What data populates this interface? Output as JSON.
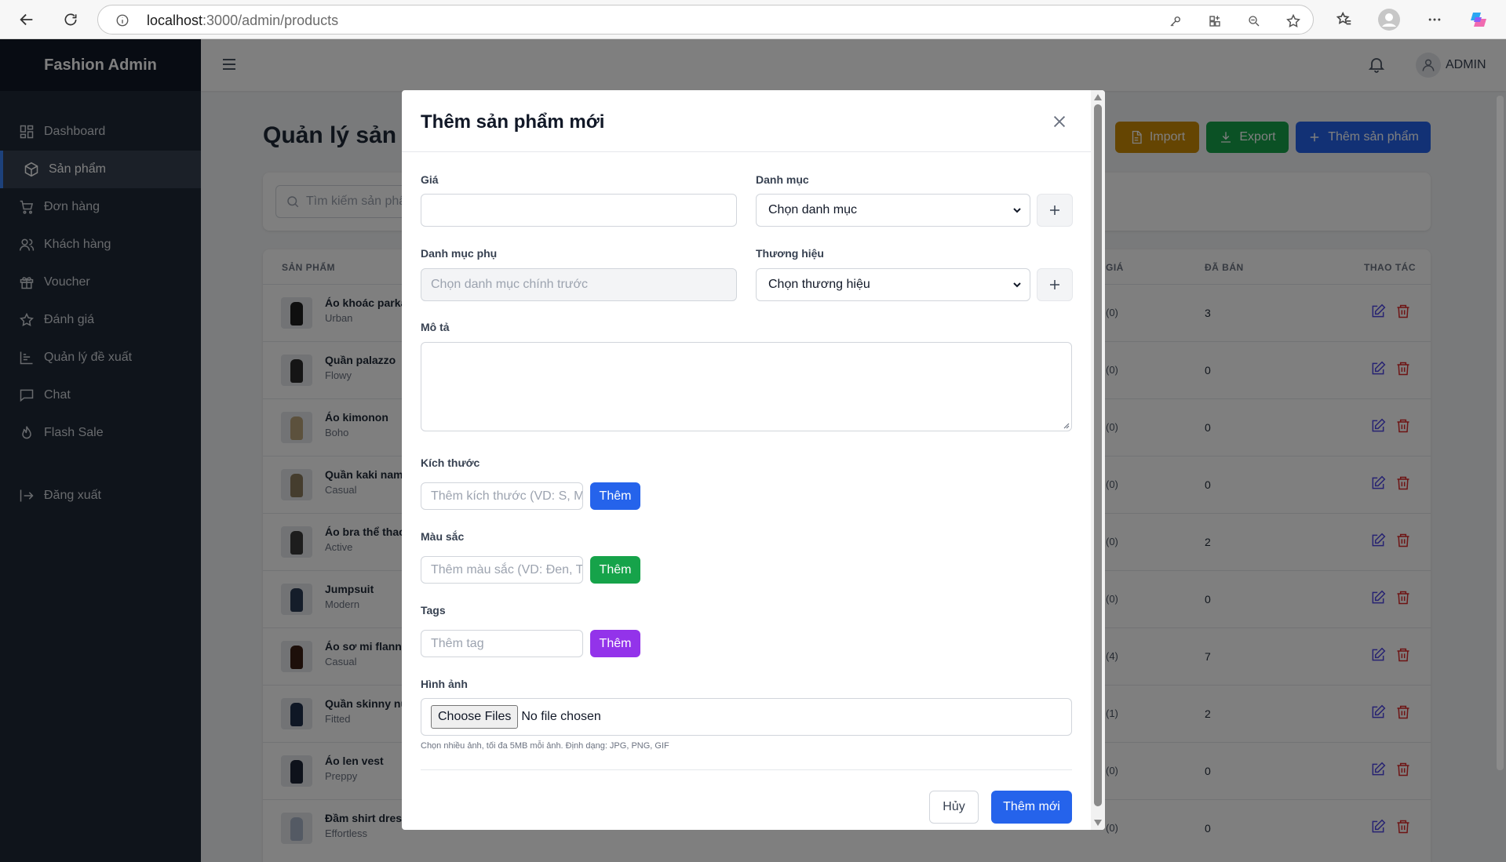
{
  "browser": {
    "url_host": "localhost",
    "url_path": ":3000/admin/products"
  },
  "sidebar": {
    "brand": "Fashion Admin",
    "items": [
      {
        "label": "Dashboard",
        "icon": "dashboard-icon"
      },
      {
        "label": "Sản phẩm",
        "icon": "box-icon",
        "active": true
      },
      {
        "label": "Đơn hàng",
        "icon": "cart-icon"
      },
      {
        "label": "Khách hàng",
        "icon": "users-icon"
      },
      {
        "label": "Voucher",
        "icon": "gift-icon"
      },
      {
        "label": "Đánh giá",
        "icon": "star-icon"
      },
      {
        "label": "Quản lý đề xuất",
        "icon": "list-icon"
      },
      {
        "label": "Chat",
        "icon": "chat-icon"
      },
      {
        "label": "Flash Sale",
        "icon": "flame-icon"
      }
    ],
    "logout": "Đăng xuất"
  },
  "topbar": {
    "user": "ADMIN"
  },
  "page": {
    "title": "Quản lý sản p",
    "import_label": "Import",
    "export_label": "Export",
    "add_label": "Thêm sản phẩm",
    "search_placeholder": "Tìm kiếm sản phẩ"
  },
  "table": {
    "headers": {
      "product": "SẢN PHẨM",
      "price": "GIÁ",
      "sold": "ĐÃ BÁN",
      "actions": "THAO TÁC"
    },
    "rows": [
      {
        "name": "Áo khoác parka",
        "brand": "Urban",
        "rating": "(0)",
        "sold": "3"
      },
      {
        "name": "Quần palazzo",
        "brand": "Flowy",
        "rating": "(0)",
        "sold": "0"
      },
      {
        "name": "Áo kimonon",
        "brand": "Boho",
        "rating": "(0)",
        "sold": "0"
      },
      {
        "name": "Quần kaki nam",
        "brand": "Casual",
        "rating": "(0)",
        "sold": "0"
      },
      {
        "name": "Áo bra thể thao",
        "brand": "Active",
        "rating": "(0)",
        "sold": "2"
      },
      {
        "name": "Jumpsuit",
        "brand": "Modern",
        "rating": "(0)",
        "sold": "0"
      },
      {
        "name": "Áo sơ mi flanne",
        "brand": "Casual",
        "rating": "(4)",
        "sold": "7"
      },
      {
        "name": "Quần skinny nữ",
        "brand": "Fitted",
        "rating": "(1)",
        "sold": "2"
      },
      {
        "name": "Áo len vest",
        "brand": "Preppy",
        "rating": "(0)",
        "sold": "0"
      },
      {
        "name": "Đầm shirt dress",
        "brand": "Effortless",
        "rating": "(0)",
        "sold": "0"
      }
    ]
  },
  "modal": {
    "title": "Thêm sản phẩm mới",
    "price_label": "Giá",
    "price_value": "",
    "category_label": "Danh mục",
    "category_value": "Chọn danh mục",
    "subcategory_label": "Danh mục phụ",
    "subcategory_placeholder": "Chọn danh mục chính trước",
    "brand_label": "Thương hiệu",
    "brand_value": "Chọn thương hiệu",
    "description_label": "Mô tả",
    "description_value": "",
    "size_label": "Kích thước",
    "size_placeholder": "Thêm kích thước (VD: S, M",
    "color_label": "Màu sắc",
    "color_placeholder": "Thêm màu sắc (VD: Đen, T",
    "tags_label": "Tags",
    "tags_placeholder": "Thêm tag",
    "add_button": "Thêm",
    "image_label": "Hình ảnh",
    "file_button": "Choose Files",
    "file_status": "No file chosen",
    "file_hint": "Chọn nhiều ảnh, tối đa 5MB mỗi ảnh. Định dạng: JPG, PNG, GIF",
    "cancel_label": "Hủy",
    "submit_label": "Thêm mới"
  },
  "colors": {
    "sidebar": "#1f2937",
    "primary": "#2563eb",
    "import": "#ca8a04",
    "export": "#16a34a",
    "tag_button": "#9333ea"
  }
}
